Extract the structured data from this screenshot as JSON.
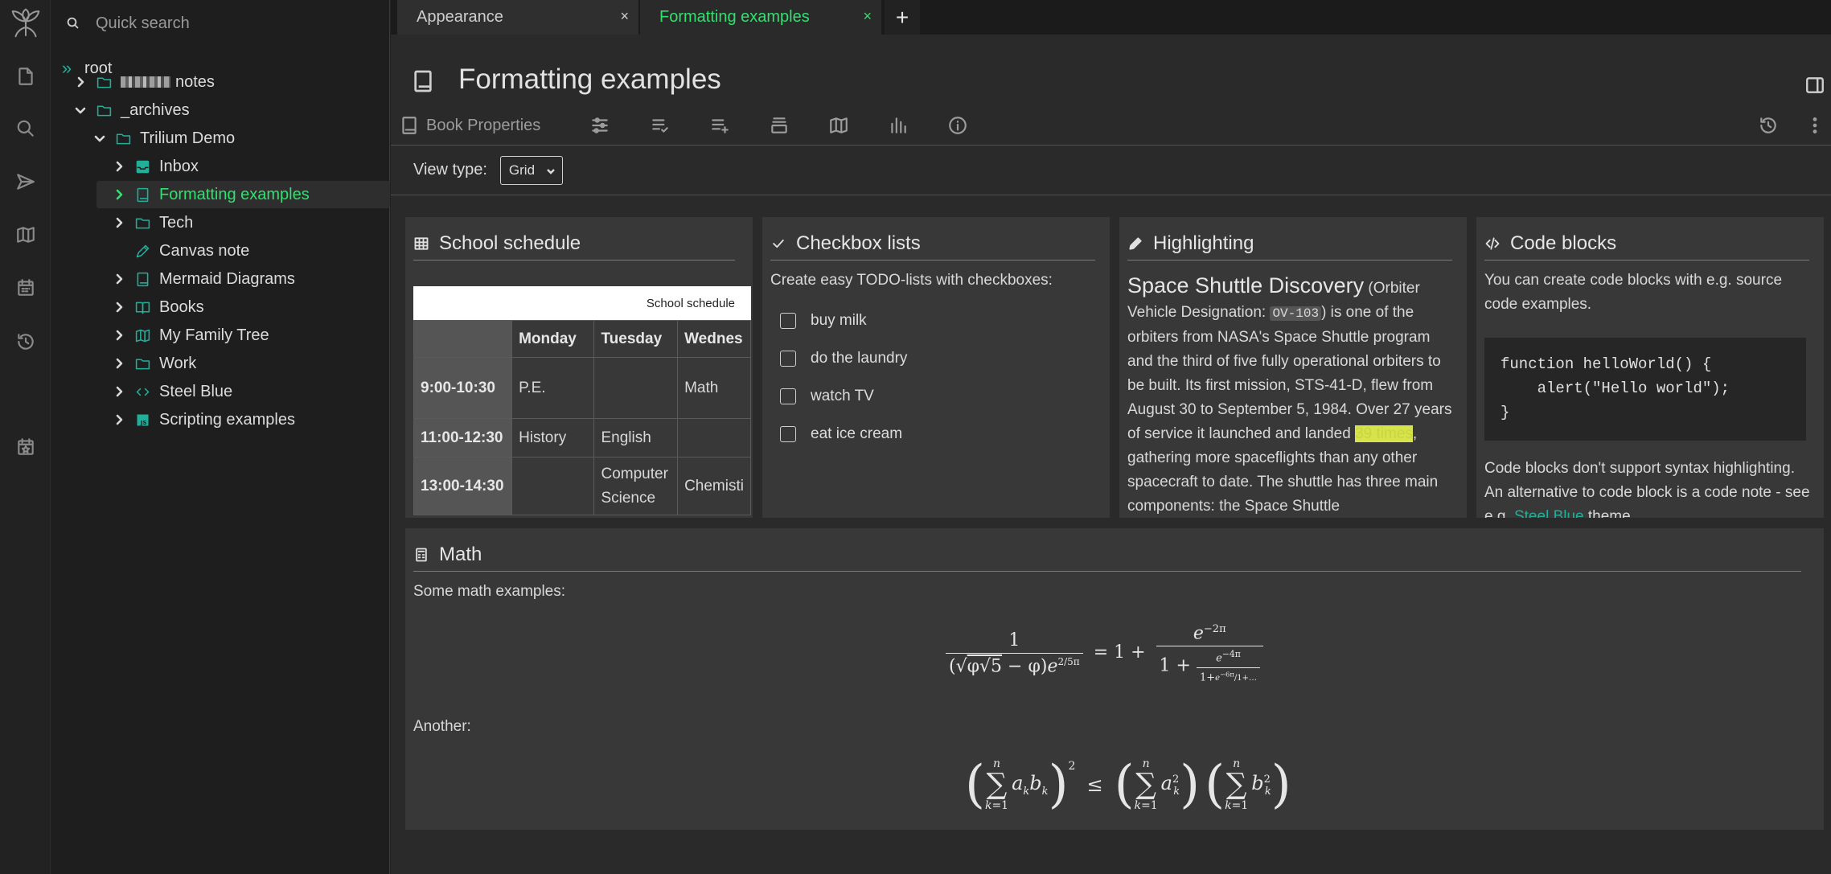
{
  "search": {
    "placeholder": "Quick search"
  },
  "launcher": [
    "new-note-icon",
    "search-icon",
    "send-icon",
    "map-icon",
    "calendar-icon",
    "history-icon",
    "bookmark-calendar-icon"
  ],
  "tree": {
    "root_label": "root",
    "items": [
      {
        "label": "notes",
        "icon": "folder-icon",
        "blurred_prefix": true
      },
      {
        "label": "_archives",
        "icon": "folder-icon"
      },
      {
        "label": "Trilium Demo",
        "icon": "folder-icon"
      },
      {
        "label": "Inbox",
        "icon": "inbox-icon"
      },
      {
        "label": "Formatting examples",
        "icon": "book-icon",
        "active": true
      },
      {
        "label": "Tech",
        "icon": "folder-icon"
      },
      {
        "label": "Canvas note",
        "icon": "pen-icon"
      },
      {
        "label": "Mermaid Diagrams",
        "icon": "book-icon"
      },
      {
        "label": "Books",
        "icon": "open-book-icon"
      },
      {
        "label": "My Family Tree",
        "icon": "map-icon"
      },
      {
        "label": "Work",
        "icon": "folder-icon"
      },
      {
        "label": "Steel Blue",
        "icon": "code-icon"
      },
      {
        "label": "Scripting examples",
        "icon": "js-icon"
      }
    ]
  },
  "tabs": [
    {
      "title": "Appearance",
      "close": "×"
    },
    {
      "title": "Formatting examples",
      "close": "×"
    }
  ],
  "new_tab": "+",
  "note": {
    "title": "Formatting examples",
    "ribbon": {
      "book_properties": "Book Properties"
    },
    "view_type_label": "View type:",
    "view_type_value": "Grid"
  },
  "cards": {
    "school": {
      "title": "School schedule",
      "caption": "School schedule",
      "headers": [
        "Monday",
        "Tuesday",
        "Wednes"
      ],
      "rows": [
        {
          "time": "9:00-10:30",
          "cells": [
            "P.E.",
            "",
            "Math"
          ]
        },
        {
          "time": "11:00-12:30",
          "cells": [
            "History",
            "English",
            ""
          ]
        },
        {
          "time": "13:00-14:30",
          "cells": [
            "",
            "Computer Science",
            "Chemisti"
          ]
        }
      ]
    },
    "checkbox": {
      "title": "Checkbox lists",
      "intro": "Create easy TODO-lists with checkboxes:",
      "items": [
        "buy milk",
        "do the laundry",
        "watch TV",
        "eat ice cream"
      ]
    },
    "highlighting": {
      "title": "Highlighting",
      "heading": "Space Shuttle Discovery",
      "text_a": " (Orbiter Vehicle Designation: ",
      "code": "OV-103",
      "text_b": ") is one of the orbiters from NASA's Space Shuttle program and the third of five fully operational orbiters to be built. Its first mission, STS-41-D, flew from August 30 to September 5, 1984. Over 27 years of service it launched and landed ",
      "highlight": "39 times",
      "text_c": ", gathering more spaceflights than any other spacecraft to date. The shuttle has three main components: the Space Shuttle"
    },
    "code": {
      "title": "Code blocks",
      "intro": "You can create code blocks with e.g. source code examples.",
      "code": "function helloWorld() {\n    alert(\"Hello world\");\n}",
      "after_a": "Code blocks don't support syntax highlighting. An alternative to code block is a code note - see e.g. ",
      "after_link": "Steel Blue",
      "after_b": " theme."
    },
    "math": {
      "title": "Math",
      "intro": "Some math examples:",
      "another": "Another:"
    }
  }
}
